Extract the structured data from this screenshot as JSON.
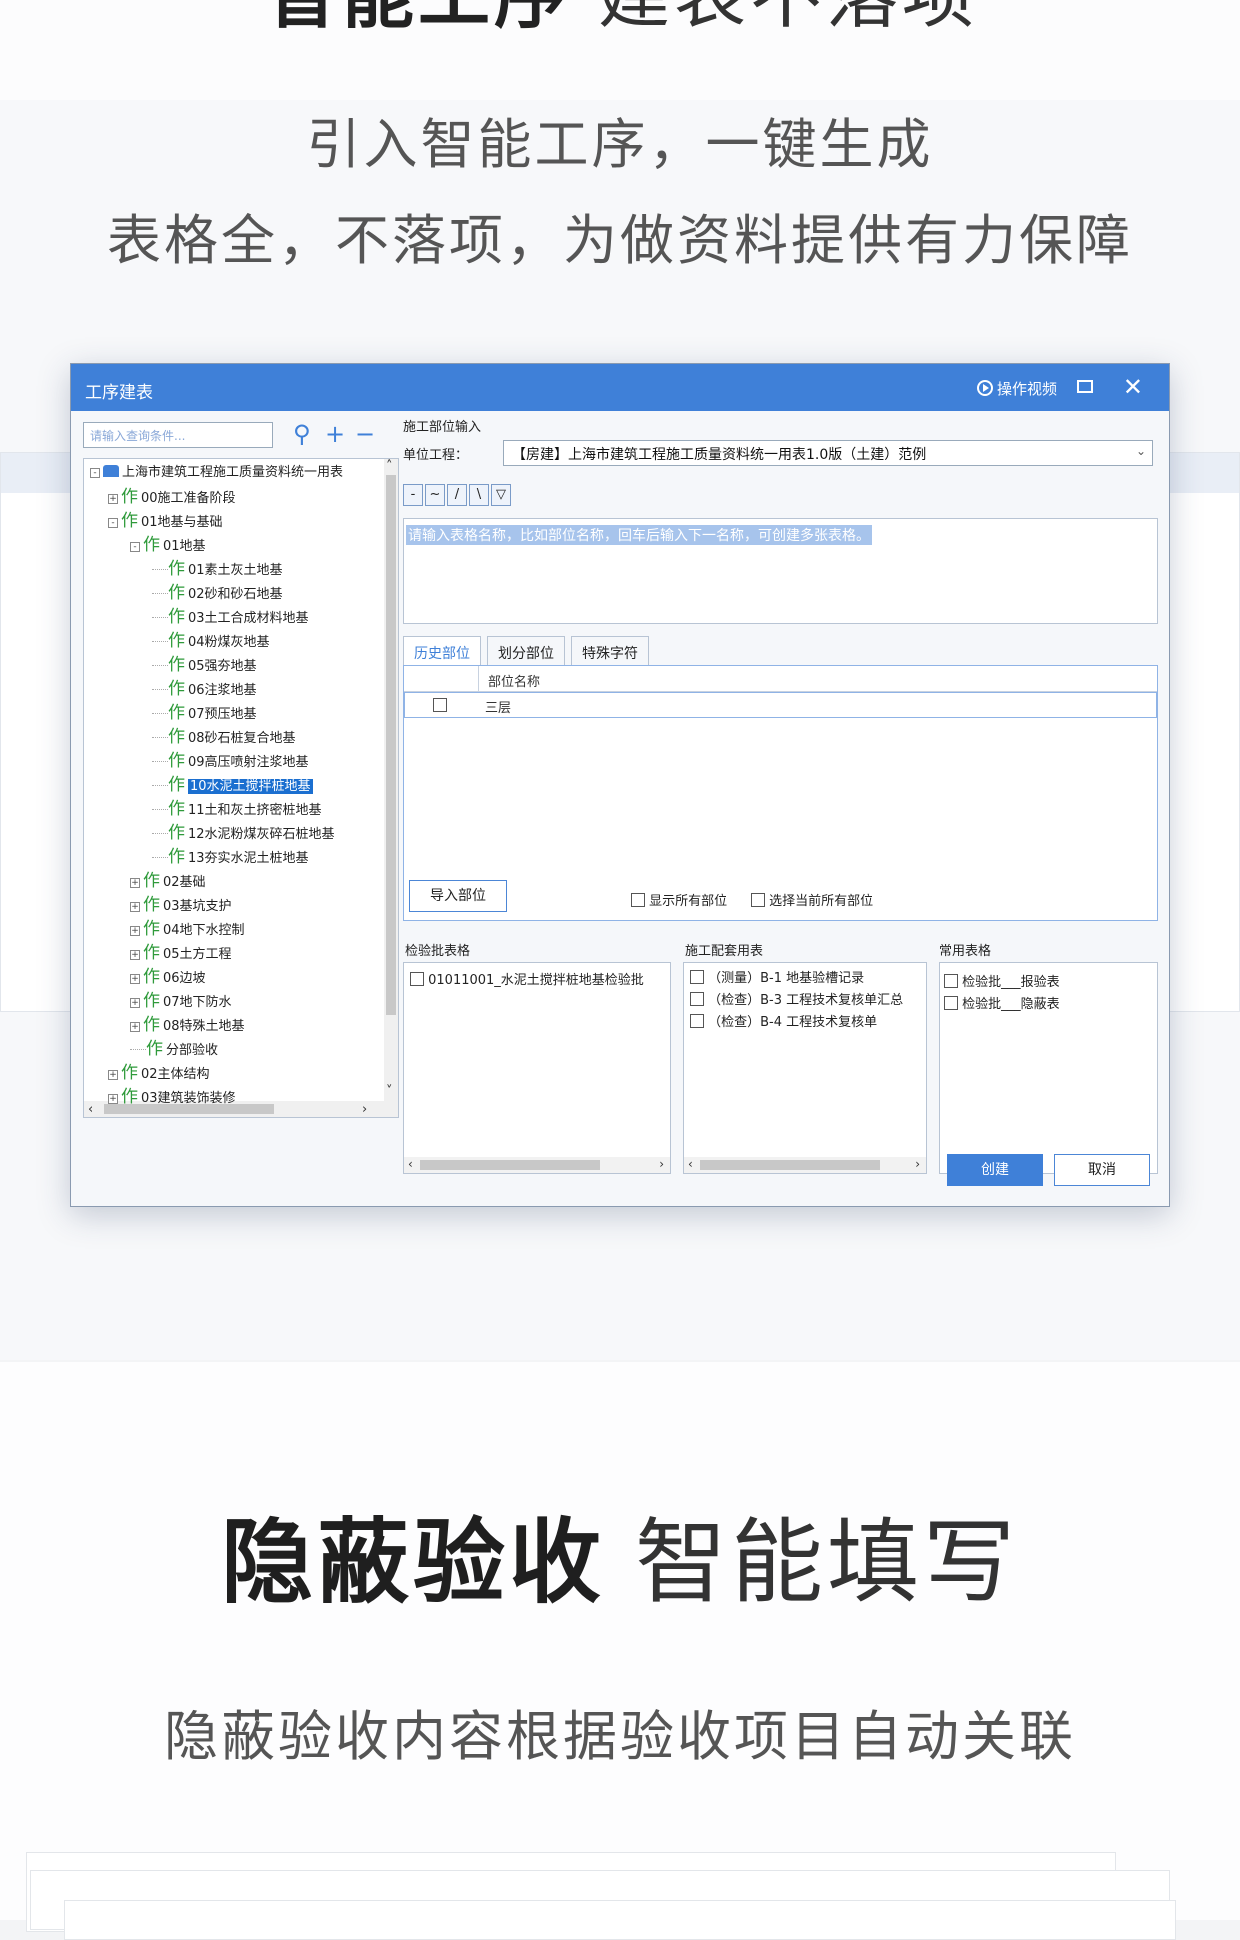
{
  "header": {
    "title_highlight": "智能工序",
    "title_rest": "建表不落项",
    "subtitle_line1": "引入智能工序，一键生成",
    "subtitle_line2": "表格全，不落项，为做资料提供有力保障"
  },
  "dialog": {
    "title": "工序建表",
    "video_label": "操作视频",
    "search_placeholder": "请输入查询条件...",
    "tree": [
      {
        "label": "上海市建筑工程施工质量资料统一用表",
        "level": 0,
        "expander": "-",
        "icon": "root",
        "selected": false
      },
      {
        "label": "00施工准备阶段",
        "level": 1,
        "expander": "+",
        "icon": "zuo",
        "selected": false
      },
      {
        "label": "01地基与基础",
        "level": 1,
        "expander": "-",
        "icon": "zuo",
        "selected": false
      },
      {
        "label": "01地基",
        "level": 2,
        "expander": "-",
        "icon": "zuo",
        "selected": false
      },
      {
        "label": "01素土灰土地基",
        "level": 3,
        "expander": "",
        "icon": "zuo",
        "selected": false
      },
      {
        "label": "02砂和砂石地基",
        "level": 3,
        "expander": "",
        "icon": "zuo",
        "selected": false
      },
      {
        "label": "03土工合成材料地基",
        "level": 3,
        "expander": "",
        "icon": "zuo",
        "selected": false
      },
      {
        "label": "04粉煤灰地基",
        "level": 3,
        "expander": "",
        "icon": "zuo",
        "selected": false
      },
      {
        "label": "05强夯地基",
        "level": 3,
        "expander": "",
        "icon": "zuo",
        "selected": false
      },
      {
        "label": "06注浆地基",
        "level": 3,
        "expander": "",
        "icon": "zuo",
        "selected": false
      },
      {
        "label": "07预压地基",
        "level": 3,
        "expander": "",
        "icon": "zuo",
        "selected": false
      },
      {
        "label": "08砂石桩复合地基",
        "level": 3,
        "expander": "",
        "icon": "zuo",
        "selected": false
      },
      {
        "label": "09高压喷射注浆地基",
        "level": 3,
        "expander": "",
        "icon": "zuo",
        "selected": false
      },
      {
        "label": "10水泥土搅拌桩地基",
        "level": 3,
        "expander": "",
        "icon": "zuo",
        "selected": true
      },
      {
        "label": "11土和灰土挤密桩地基",
        "level": 3,
        "expander": "",
        "icon": "zuo",
        "selected": false
      },
      {
        "label": "12水泥粉煤灰碎石桩地基",
        "level": 3,
        "expander": "",
        "icon": "zuo",
        "selected": false
      },
      {
        "label": "13夯实水泥土桩地基",
        "level": 3,
        "expander": "",
        "icon": "zuo",
        "selected": false
      },
      {
        "label": "02基础",
        "level": 2,
        "expander": "+",
        "icon": "zuo",
        "selected": false
      },
      {
        "label": "03基坑支护",
        "level": 2,
        "expander": "+",
        "icon": "zuo",
        "selected": false
      },
      {
        "label": "04地下水控制",
        "level": 2,
        "expander": "+",
        "icon": "zuo",
        "selected": false
      },
      {
        "label": "05土方工程",
        "level": 2,
        "expander": "+",
        "icon": "zuo",
        "selected": false
      },
      {
        "label": "06边坡",
        "level": 2,
        "expander": "+",
        "icon": "zuo",
        "selected": false
      },
      {
        "label": "07地下防水",
        "level": 2,
        "expander": "+",
        "icon": "zuo",
        "selected": false
      },
      {
        "label": "08特殊土地基",
        "level": 2,
        "expander": "+",
        "icon": "zuo",
        "selected": false
      },
      {
        "label": "分部验收",
        "level": 2,
        "expander": "",
        "icon": "zuo",
        "selected": false
      },
      {
        "label": "02主体结构",
        "level": 1,
        "expander": "+",
        "icon": "zuo",
        "selected": false
      },
      {
        "label": "03建筑装饰装修",
        "level": 1,
        "expander": "+",
        "icon": "zuo",
        "selected": false
      }
    ],
    "section_label": "施工部位输入",
    "unit_label": "单位工程：",
    "unit_value": "【房建】上海市建筑工程施工质量资料统一用表1.0版（土建）范例",
    "symbols": [
      "-",
      "~",
      "/",
      "\\",
      "▽"
    ],
    "input_placeholder": "请输入表格名称，比如部位名称，回车后输入下一名称，可创建多张表格。",
    "tabs": [
      "历史部位",
      "划分部位",
      "特殊字符"
    ],
    "grid_header": "部位名称",
    "grid_rows": [
      "三层"
    ],
    "import_button": "导入部位",
    "option_show_all": "显示所有部位",
    "option_select_all": "选择当前所有部位",
    "panel_inspection": {
      "title": "检验批表格",
      "items": [
        "01011001_水泥土搅拌桩地基检验批"
      ]
    },
    "panel_support": {
      "title": "施工配套用表",
      "items": [
        "（测量）B-1 地基验槽记录",
        "（检查）B-3 工程技术复核单汇总",
        "（检查）B-4 工程技术复核单"
      ]
    },
    "panel_common": {
      "title": "常用表格",
      "items": [
        "检验批___报验表",
        "检验批___隐蔽表"
      ]
    },
    "create_button": "创建",
    "cancel_button": "取消"
  },
  "section2": {
    "title_highlight": "隐蔽验收",
    "title_rest": "智能填写",
    "subtitle": "隐蔽验收内容根据验收项目自动关联"
  },
  "colors": {
    "accent": "#3f80d8",
    "highlight": "#3a78e6",
    "selected": "#1b6fd0",
    "tree_icon": "#2e9a3a"
  }
}
